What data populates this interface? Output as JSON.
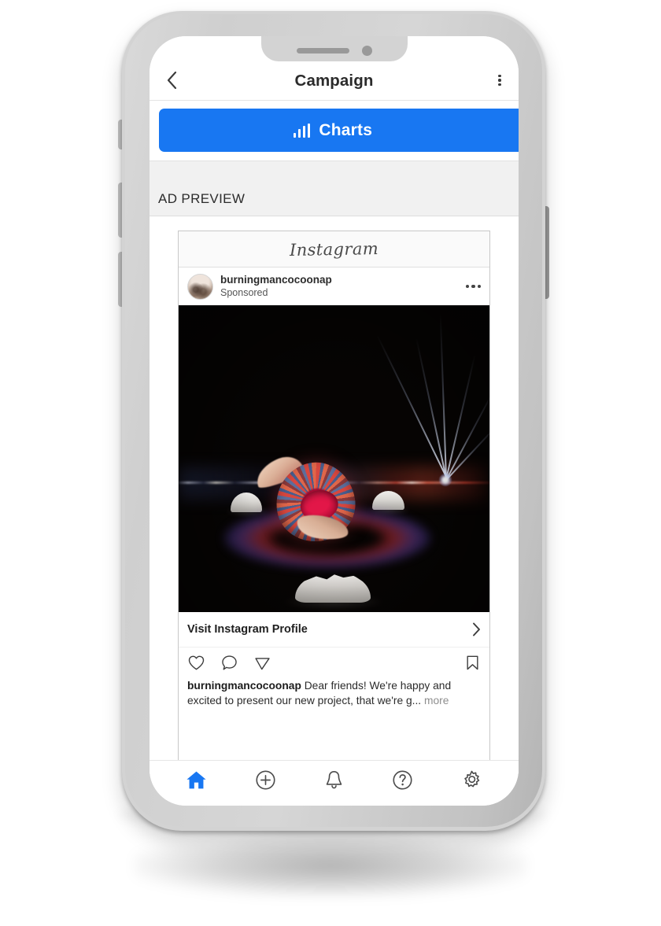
{
  "device": {
    "frame": "iphone-x",
    "notch": {
      "speaker": "speaker-grille",
      "camera": "front-camera"
    }
  },
  "header": {
    "back_icon": "chevron-left-icon",
    "title": "Campaign",
    "overflow_icon": "kebab-menu-icon"
  },
  "toolbar": {
    "charts_label": "Charts",
    "charts_icon": "bar-chart-icon",
    "charts_color": "#1877f2"
  },
  "section": {
    "label": "AD PREVIEW"
  },
  "ad_preview": {
    "platform_wordmark": "Instagram",
    "account": {
      "avatar": "profile-avatar",
      "username": "burningmancocoonap",
      "subtitle": "Sponsored",
      "more_icon": "more-options-icon"
    },
    "creative": {
      "alt": "night desert scene with illuminated patterned cocoon pod, domes and light beams",
      "background_color": "#060403"
    },
    "cta": {
      "label": "Visit Instagram Profile",
      "chevron_icon": "chevron-right-icon"
    },
    "actions": [
      {
        "name": "like",
        "icon": "heart-icon"
      },
      {
        "name": "comment",
        "icon": "comment-icon"
      },
      {
        "name": "share",
        "icon": "paper-plane-icon"
      },
      {
        "name": "save",
        "icon": "bookmark-icon"
      }
    ],
    "caption": {
      "username": "burningmancocoonap",
      "text": " Dear friends! We're happy and excited to present our new project, that we're g...",
      "more_label": "more"
    }
  },
  "tabbar": {
    "active_color": "#1877f2",
    "items": [
      {
        "name": "home",
        "icon": "home-icon",
        "active": true
      },
      {
        "name": "create",
        "icon": "plus-circle-icon",
        "active": false
      },
      {
        "name": "notifications",
        "icon": "bell-icon",
        "active": false
      },
      {
        "name": "help",
        "icon": "question-circle-icon",
        "active": false
      },
      {
        "name": "settings",
        "icon": "gear-icon",
        "active": false
      }
    ]
  }
}
